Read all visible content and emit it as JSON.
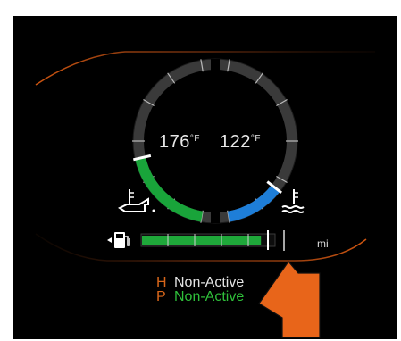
{
  "gauges": {
    "oil_temp": {
      "value": "176",
      "unit": "°F",
      "icon": "oil-can-thermometer-icon",
      "level": 0.42,
      "color": "#19a43a"
    },
    "coolant_temp": {
      "value": "122",
      "unit": "°F",
      "icon": "coolant-thermometer-icon",
      "level": 0.2,
      "color": "#1e7ed8"
    }
  },
  "fuel": {
    "icon": "fuel-pump-icon",
    "level": 0.9,
    "unit": "mi",
    "color": "#1fa83a"
  },
  "status": [
    {
      "key": "H",
      "value": "Non-Active",
      "key_color": "#d8661a",
      "value_color": "#e4e4e4"
    },
    {
      "key": "P",
      "value": "Non-Active",
      "key_color": "#d8661a",
      "value_color": "#2fbf3a"
    }
  ],
  "accent_color": "#e35e12",
  "pointer": {
    "icon": "orange-arrow-pointer-icon",
    "color": "#e8651a"
  }
}
